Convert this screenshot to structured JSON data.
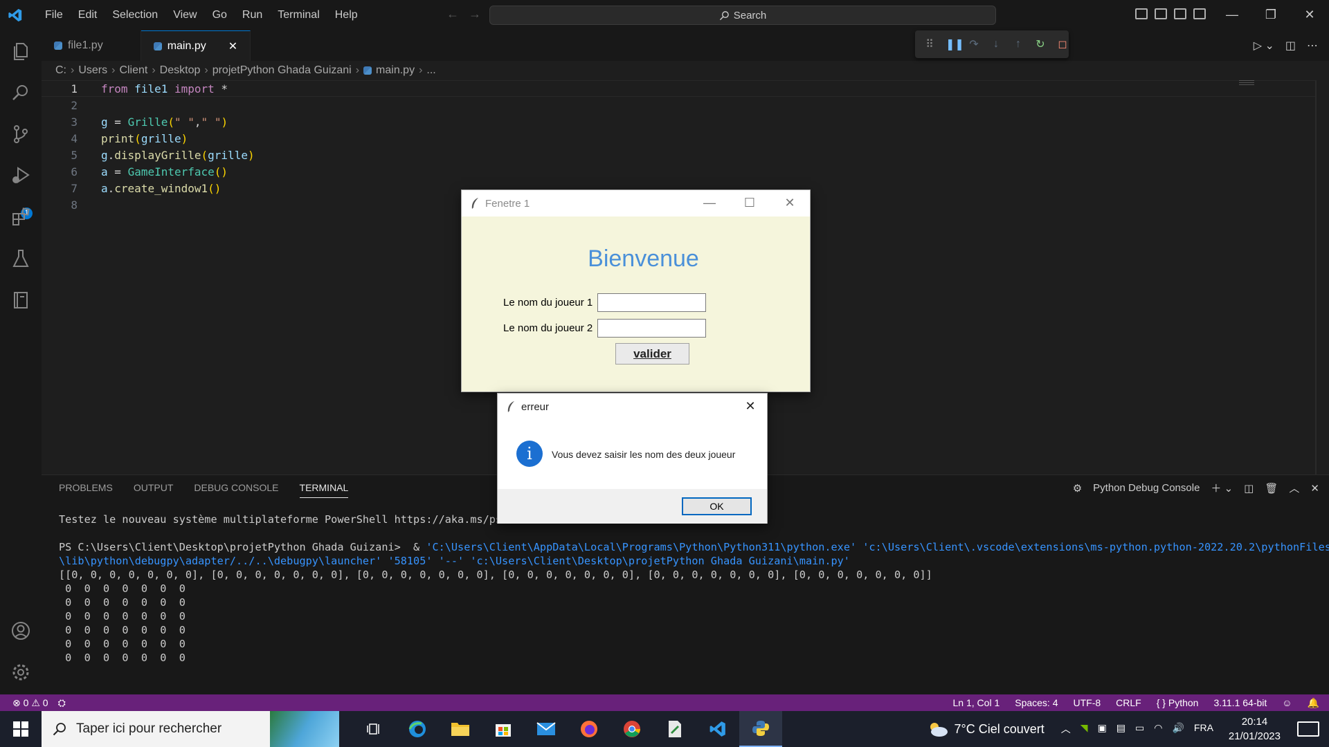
{
  "menu": [
    "File",
    "Edit",
    "Selection",
    "View",
    "Go",
    "Run",
    "Terminal",
    "Help"
  ],
  "search": {
    "label": "Search"
  },
  "tabs": [
    {
      "label": "file1.py"
    },
    {
      "label": "main.py"
    }
  ],
  "breadcrumb": [
    "C:",
    "Users",
    "Client",
    "Desktop",
    "projetPython Ghada Guizani",
    "main.py",
    "..."
  ],
  "code": {
    "line_numbers": [
      "1",
      "2",
      "3",
      "4",
      "5",
      "6",
      "7",
      "8"
    ]
  },
  "activity": {
    "debug_badge": "1"
  },
  "panel": {
    "tabs": [
      "PROBLEMS",
      "OUTPUT",
      "DEBUG CONSOLE",
      "TERMINAL"
    ],
    "console_label": "Python Debug Console",
    "terminal": {
      "line1": "Testez le nouveau système multiplateforme PowerShell https://aka.ms/pscore6",
      "prompt": "PS C:\\Users\\Client\\Desktop\\projetPython Ghada Guizani>  & ",
      "cmd1": "'C:\\Users\\Client\\AppData\\Local\\Programs\\Python\\Python311\\python.exe' 'c:\\Users\\Client\\.vscode\\extensions\\ms-python.python-2022.20.2\\pythonFiles",
      "cmd2": "\\lib\\python\\debugpy\\adapter/../..\\debugpy\\launcher' '58105' '--' 'c:\\Users\\Client\\Desktop\\projetPython Ghada Guizani\\main.py'",
      "list": "[[0, 0, 0, 0, 0, 0, 0], [0, 0, 0, 0, 0, 0, 0], [0, 0, 0, 0, 0, 0, 0], [0, 0, 0, 0, 0, 0, 0], [0, 0, 0, 0, 0, 0, 0], [0, 0, 0, 0, 0, 0, 0]]",
      "grid_row": " 0  0  0  0  0  0  0"
    }
  },
  "status": {
    "errors": "0",
    "warnings": "0",
    "position": "Ln 1, Col 1",
    "spaces": "Spaces: 4",
    "encoding": "UTF-8",
    "eol": "CRLF",
    "language": "Python",
    "interpreter": "3.11.1 64-bit"
  },
  "taskbar": {
    "search_placeholder": "Taper ici pour rechercher",
    "weather": "7°C  Ciel couvert",
    "lang": "FRA",
    "time": "20:14",
    "date": "21/01/2023"
  },
  "fenetre1": {
    "title": "Fenetre 1",
    "heading": "Bienvenue",
    "label1": "Le nom du joueur 1",
    "label2": "Le nom du joueur 2",
    "button": "valider",
    "player1_value": "",
    "player2_value": ""
  },
  "erreur": {
    "title": "erreur",
    "message": "Vous devez saisir les nom des deux joueur",
    "ok": "OK"
  },
  "colors": {
    "status_bar": "#68217a",
    "accent": "#0078d4",
    "tk_background": "#f5f5dc",
    "heading": "#4a90d9"
  }
}
